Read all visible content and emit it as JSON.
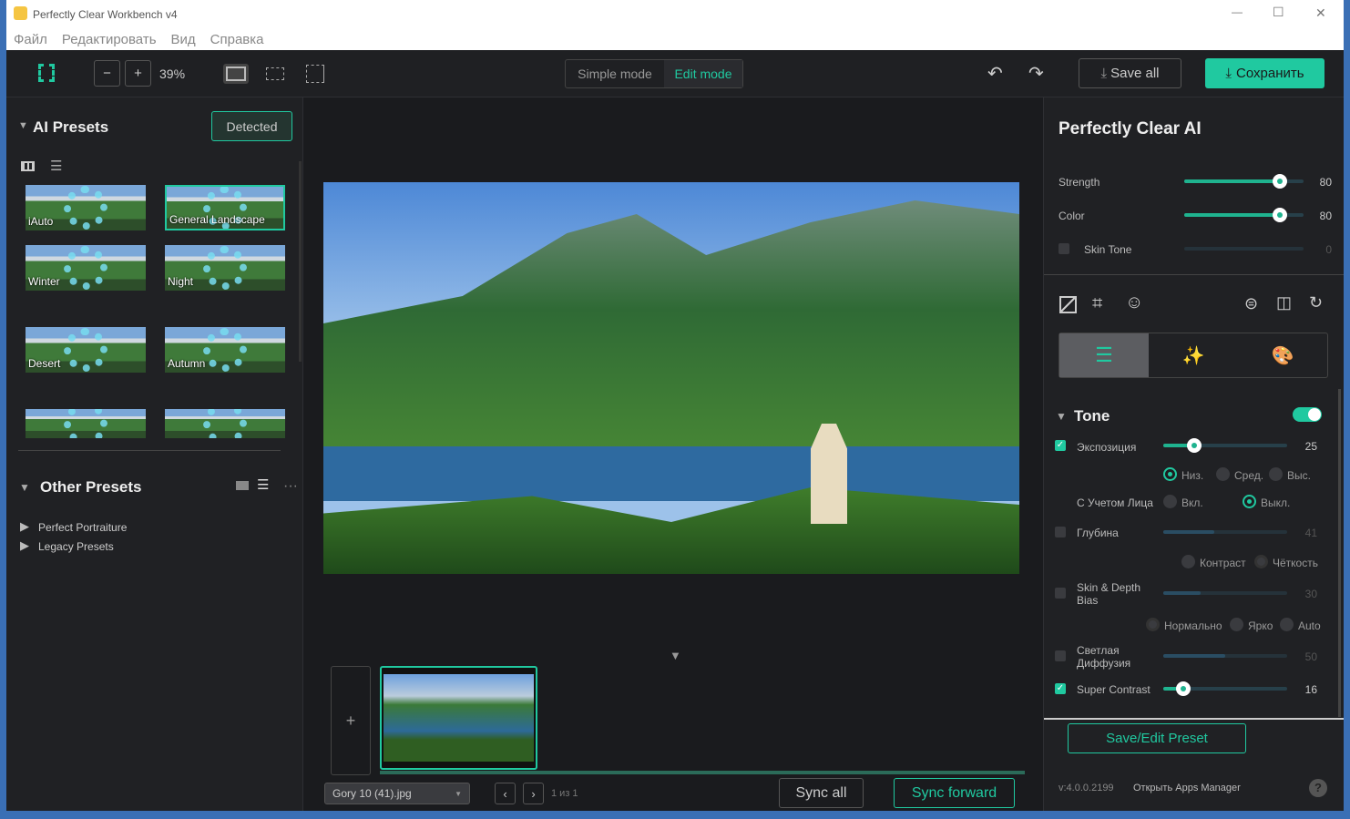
{
  "window": {
    "title": "Perfectly Clear Workbench v4",
    "minimize": "—",
    "maximize": "☐",
    "close": "✕"
  },
  "menu": [
    "Файл",
    "Редактировать",
    "Вид",
    "Справка"
  ],
  "toolbar": {
    "zoom": "39%",
    "minus": "−",
    "plus": "+",
    "simple_mode": "Simple mode",
    "edit_mode": "Edit mode",
    "save_all": "Save all",
    "save": "Сохранить"
  },
  "left": {
    "ai_presets": "AI Presets",
    "detected": "Detected",
    "presets": [
      "iAuto",
      "General Landscape",
      "Winter",
      "Night",
      "Desert",
      "Autumn",
      "",
      ""
    ],
    "other_presets": "Other Presets",
    "more": "···",
    "tree": [
      "Perfect Portraiture",
      "Legacy Presets"
    ]
  },
  "filmstrip": {
    "add": "+",
    "filename": "Gory 10 (41).jpg",
    "page": "1 из 1",
    "sync_all": "Sync all",
    "sync_forward": "Sync forward"
  },
  "right": {
    "title": "Perfectly Clear AI",
    "strength": {
      "label": "Strength",
      "value": 80
    },
    "color": {
      "label": "Color",
      "value": 80
    },
    "skin_tone": {
      "label": "Skin Tone",
      "value": 0,
      "checked": false
    },
    "tone": {
      "title": "Tone",
      "enabled": true,
      "exposure": {
        "label": "Экспозиция",
        "value": 25,
        "checked": true
      },
      "levels": [
        "Низ.",
        "Сред.",
        "Выс."
      ],
      "level_selected": "Низ.",
      "face_label": "С Учетом Лица",
      "face_on": "Вкл.",
      "face_off": "Выкл.",
      "face_selected": "Выкл.",
      "depth": {
        "label": "Глубина",
        "value": 41,
        "checked": false
      },
      "depth_modes": [
        "Контраст",
        "Чёткость"
      ],
      "skin_depth": {
        "label": "Skin & Depth Bias",
        "value": 30,
        "checked": false
      },
      "bias_modes": [
        "Нормально",
        "Ярко",
        "Auto"
      ],
      "diffusion": {
        "label": "Светлая Диффузия",
        "value": 50,
        "checked": false
      },
      "super_contrast": {
        "label": "Super Contrast",
        "value": 16,
        "checked": true
      }
    },
    "save_preset": "Save/Edit Preset",
    "version": "v:4.0.0.2199",
    "apps_manager": "Открыть Apps Manager",
    "help": "?"
  },
  "accent": "#20c9a0"
}
